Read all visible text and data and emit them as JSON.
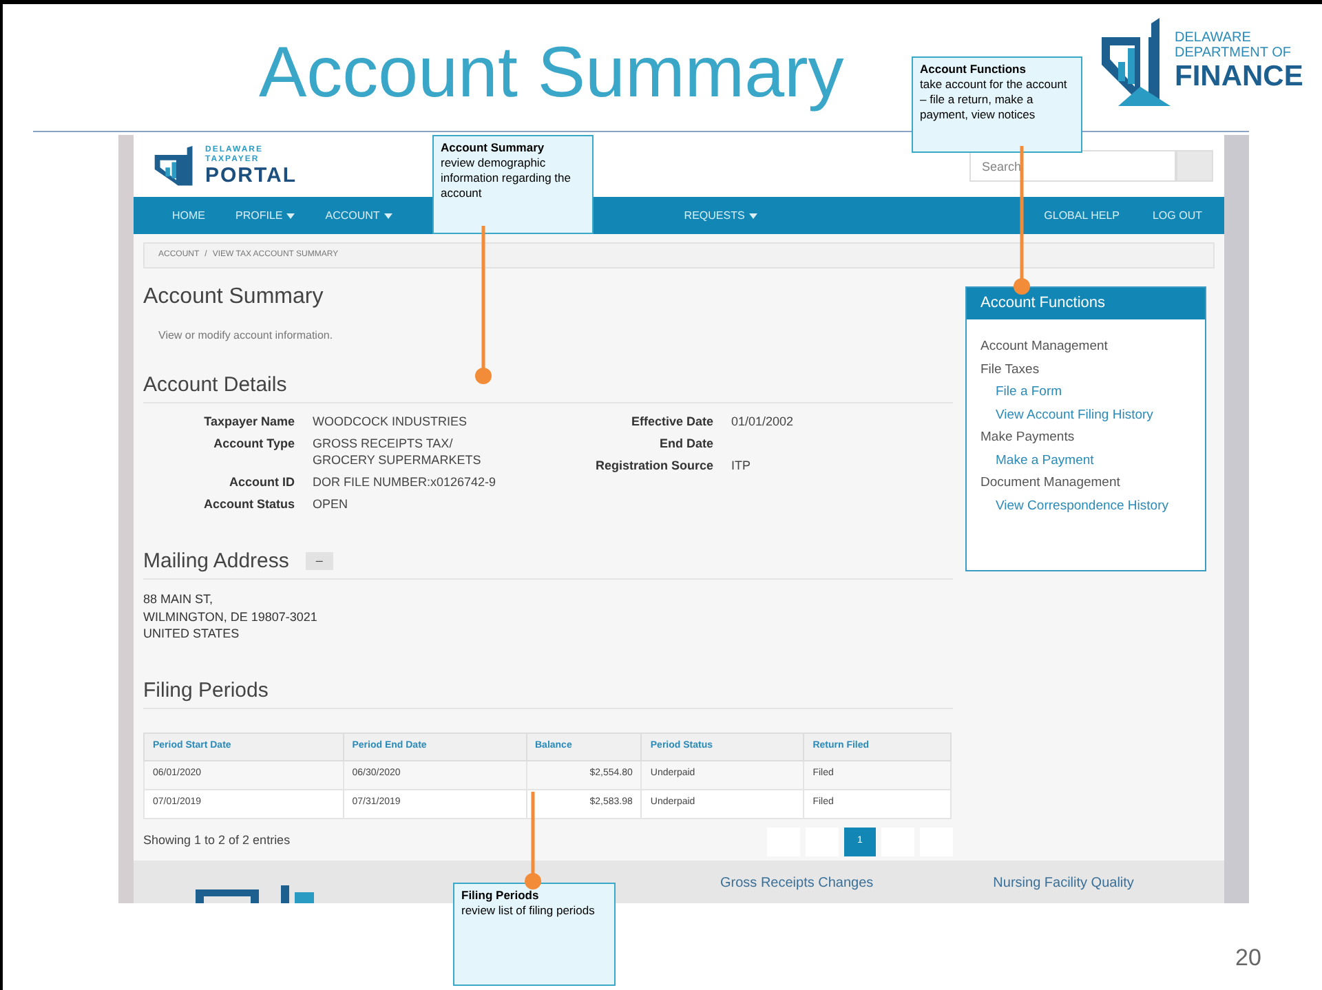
{
  "slide": {
    "title": "Account Summary",
    "page_number": "20",
    "logo": {
      "line_1": "DELAWARE",
      "line_2": "DEPARTMENT OF",
      "line_3": "FINANCE"
    }
  },
  "portal": {
    "logo": {
      "line_1": "DELAWARE",
      "line_2": "TAXPAYER",
      "line_3": "PORTAL"
    },
    "search": {
      "placeholder": "Search"
    },
    "nav": [
      {
        "label": "HOME",
        "dropdown": false
      },
      {
        "label": "PROFILE",
        "dropdown": true
      },
      {
        "label": "ACCOUNT",
        "dropdown": true
      },
      {
        "label": "REQUESTS",
        "dropdown": true
      }
    ],
    "nav_right": [
      "GLOBAL HELP",
      "LOG OUT"
    ],
    "breadcrumb": [
      "ACCOUNT",
      "/",
      "VIEW TAX ACCOUNT SUMMARY"
    ],
    "page_title": "Account Summary",
    "description": "View or modify account information.",
    "account_details": {
      "heading": "Account Details",
      "left": [
        {
          "label": "Taxpayer Name",
          "value": [
            "WOODCOCK INDUSTRIES"
          ]
        },
        {
          "label": "Account Type",
          "value": [
            "GROSS RECEIPTS TAX/",
            "GROCERY SUPERMARKETS"
          ]
        },
        {
          "label": "Account ID",
          "value": [
            "DOR FILE NUMBER:x0126742-9"
          ]
        },
        {
          "label": "Account Status",
          "value": [
            "OPEN"
          ]
        }
      ],
      "right": [
        {
          "label": "Effective Date",
          "value": [
            "01/01/2002"
          ]
        },
        {
          "label": "End Date"
        },
        {
          "label": "Registration Source",
          "value": [
            "ITP"
          ]
        }
      ]
    },
    "mailing_address": {
      "heading": "Mailing Address",
      "toggle": "–",
      "lines": [
        "88 MAIN ST,",
        "WILMINGTON, DE 19807-3021",
        "UNITED STATES"
      ]
    },
    "filing_periods": {
      "heading": "Filing Periods",
      "columns": [
        "Period Start Date",
        "Period End Date",
        "Balance",
        "Period Status",
        "Return Filed"
      ],
      "rows": [
        [
          "06/01/2020",
          "06/30/2020",
          "$2,554.80",
          "Underpaid",
          "Filed"
        ],
        [
          "07/01/2019",
          "07/31/2019",
          "$2,583.98",
          "Underpaid",
          "Filed"
        ]
      ],
      "summary": "Showing 1 to 2 of 2 entries",
      "pagination": [
        {
          "selected": false
        },
        {
          "selected": false
        },
        {
          "label": "1",
          "selected": true
        },
        {
          "selected": false
        },
        {
          "selected": false
        }
      ]
    },
    "account_functions": {
      "title": "Account Functions",
      "items": [
        {
          "kind": "heading",
          "label": "Account Management"
        },
        {
          "kind": "heading",
          "label": "File Taxes"
        },
        {
          "kind": "link",
          "label": "File a Form"
        },
        {
          "kind": "link",
          "label": "View Account Filing History"
        },
        {
          "kind": "heading",
          "label": "Make Payments"
        },
        {
          "kind": "link",
          "label": "Make a Payment"
        },
        {
          "kind": "heading",
          "label": "Document Management"
        },
        {
          "kind": "link",
          "label": "View Correspondence History"
        }
      ]
    },
    "footer": {
      "links": [
        "Gross Receipts Changes",
        "Nursing Facility Quality"
      ]
    }
  },
  "callouts": [
    {
      "title": "Account Summary",
      "text": "review demographic information regarding the account"
    },
    {
      "title": "Account Functions",
      "text": "take account for the account – file a return, make a payment, view notices"
    },
    {
      "title": "Filing Periods",
      "text": "review list of filing periods"
    }
  ]
}
